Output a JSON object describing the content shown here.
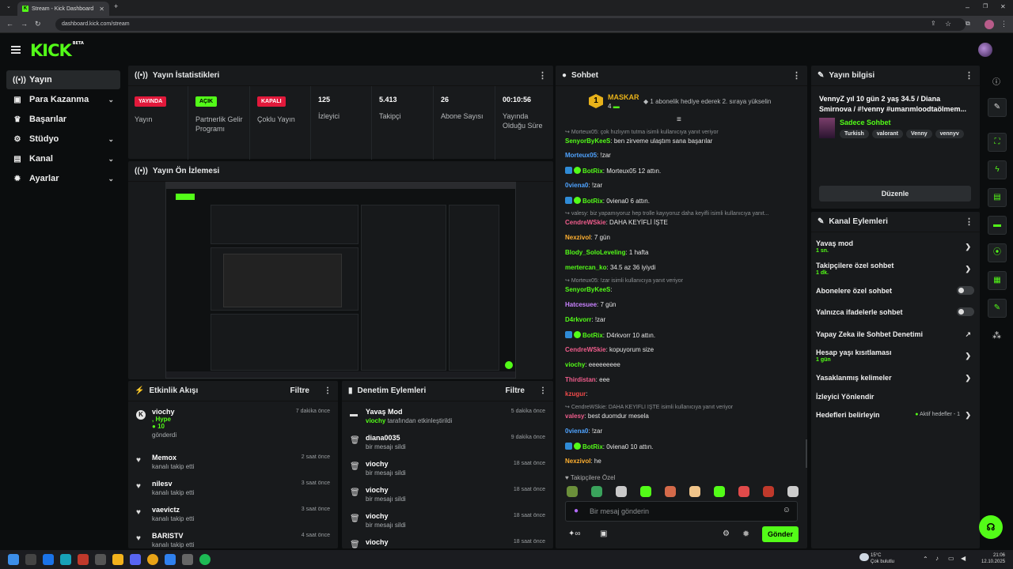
{
  "browser": {
    "tab_title": "Stream - Kick Dashboard",
    "url": "dashboard.kick.com/stream"
  },
  "brand": {
    "logo": "KICK",
    "beta": "BETA",
    "accent": "#53fc18"
  },
  "sidebar": {
    "items": [
      {
        "label": "Yayın",
        "icon": "broadcast-icon"
      },
      {
        "label": "Para Kazanma",
        "icon": "wallet-icon"
      },
      {
        "label": "Başarılar",
        "icon": "trophy-icon"
      },
      {
        "label": "Stüdyo",
        "icon": "gear-icon"
      },
      {
        "label": "Kanal",
        "icon": "folder-icon"
      },
      {
        "label": "Ayarlar",
        "icon": "settings-icon"
      }
    ]
  },
  "stats": {
    "title": "Yayın İstatistikleri",
    "items": [
      {
        "badge": "YAYINDA",
        "label": "Yayın"
      },
      {
        "badge": "AÇIK",
        "label": "Partnerlik Gelir Programı"
      },
      {
        "badge": "KAPALI",
        "label": "Çoklu Yayın"
      },
      {
        "value": "125",
        "label": "İzleyici"
      },
      {
        "value": "5.413",
        "label": "Takipçi"
      },
      {
        "value": "26",
        "label": "Abone Sayısı"
      },
      {
        "value": "00:10:56",
        "label": "Yayında Olduğu Süre"
      }
    ]
  },
  "preview": {
    "title": "Yayın Ön İzlemesi"
  },
  "activity": {
    "title": "Etkinlik Akışı",
    "filter": "Filtre",
    "rows": [
      {
        "name": "viochy",
        "line2": ", Hype",
        "line3": "10",
        "line4": "gönderdi",
        "time": "7 dakika önce"
      },
      {
        "name": "Memox",
        "sub": "kanalı takip etti",
        "time": "2 saat önce"
      },
      {
        "name": "nilesv",
        "sub": "kanalı takip etti",
        "time": "3 saat önce"
      },
      {
        "name": "vaevictz",
        "sub": "kanalı takip etti",
        "time": "3 saat önce"
      },
      {
        "name": "BARISTV",
        "sub": "kanalı takip etti",
        "time": "4 saat önce"
      }
    ]
  },
  "moderation": {
    "title": "Denetim Eylemleri",
    "filter": "Filtre",
    "rows": [
      {
        "name": "Yavaş Mod",
        "sub_user": "viochy",
        "sub": "tarafından etkinleştirildi",
        "time": "5 dakika önce"
      },
      {
        "name": "diana0035",
        "sub": "bir mesajı sildi",
        "time": "9 dakika önce"
      },
      {
        "name": "viochy",
        "sub": "bir mesajı sildi",
        "time": "18 saat önce"
      },
      {
        "name": "viochy",
        "sub": "bir mesajı sildi",
        "time": "18 saat önce"
      },
      {
        "name": "viochy",
        "sub": "bir mesajı sildi",
        "time": "18 saat önce"
      },
      {
        "name": "viochy",
        "sub": "",
        "time": "18 saat önce"
      }
    ]
  },
  "chat": {
    "title": "Sohbet",
    "pinned_user": "MASKAR",
    "pinned_count": "4",
    "pinned_rank": "1",
    "pinned_msg": "1 abonelik hediye ederek 2. sıraya yükselin",
    "messages": [
      {
        "reply": "Morteux05: çok hızlıyım tutma isimli kullanıcıya yanıt veriyor"
      },
      {
        "user": "SenyorByKeeS",
        "color": "#53fc18",
        "text": "ben zirveme ulaştım sana başarılar"
      },
      {
        "user": "Morteux05",
        "color": "#4fa3ff",
        "text": "!zar"
      },
      {
        "user": "BotRix",
        "color": "#53fc18",
        "text": "Morteux05 12 attın.",
        "badges": true
      },
      {
        "user": "0viena0",
        "color": "#4fa3ff",
        "text": "!zar"
      },
      {
        "user": "BotRix",
        "color": "#53fc18",
        "text": "0viena0 6 attın.",
        "badges": true
      },
      {
        "reply": "valesy: biz yapamıyoruz hep trolle kayıyoruz daha keyifli isimli kullanıcıya yanıt..."
      },
      {
        "user": "CendreWSkie",
        "color": "#f05d8c",
        "text": "DAHA KEYİFLİ İŞTE"
      },
      {
        "user": "Nexzivol",
        "color": "#ffb030",
        "text": "7 gün"
      },
      {
        "user": "Blody_SoloLeveling",
        "color": "#53fc18",
        "text": "1 hafta"
      },
      {
        "user": "mertercan_ko",
        "color": "#53fc18",
        "text": "34.5 az 36 iyiydi"
      },
      {
        "reply": "Morteux05: !zar isimli kullanıcıya yanıt veriyor"
      },
      {
        "user": "SenyorByKeeS",
        "color": "#53fc18",
        "text": ""
      },
      {
        "user": "Hatcesuee",
        "color": "#c982ff",
        "text": "7 gün"
      },
      {
        "user": "D4rkvorr",
        "color": "#53fc18",
        "text": "!zar"
      },
      {
        "user": "BotRix",
        "color": "#53fc18",
        "text": "D4rkvorr 10 attın.",
        "badges": true
      },
      {
        "user": "CendreWSkie",
        "color": "#f05d8c",
        "text": "kopuyorum size"
      },
      {
        "user": "viochy",
        "color": "#53fc18",
        "text": "eeeeeeeee"
      },
      {
        "user": "Thirdistan",
        "color": "#f05d8c",
        "text": "eee"
      },
      {
        "user": "kzugur",
        "color": "#f04a4a",
        "text": ""
      },
      {
        "reply": "CendreWSkie: DAHA KEYİFLİ İŞTE isimli kullanıcıya yanıt veriyor"
      },
      {
        "user": "valesy",
        "color": "#f05d8c",
        "text": "best duomdur mesela"
      },
      {
        "user": "0viena0",
        "color": "#4fa3ff",
        "text": "!zar"
      },
      {
        "user": "BotRix",
        "color": "#53fc18",
        "text": "0viena0 10 attın.",
        "badges": true
      },
      {
        "user": "Nexzivol",
        "color": "#ffb030",
        "text": "he"
      }
    ],
    "emote_label": "Takipçilere Özel",
    "input_placeholder": "Bir mesaj gönderin",
    "send_label": "Gönder"
  },
  "stream_info": {
    "title": "Yayın bilgisi",
    "stream_title": "VennyZ yıl 10 gün 2 yaş 34.5 / Diana Smirnova / #!venny #umarımloodtaölmem...",
    "category": "Sadece Sohbet",
    "tags": [
      "Turkish",
      "valorant",
      "Venny",
      "vennyv"
    ],
    "edit_label": "Düzenle"
  },
  "channel_actions": {
    "title": "Kanal Eylemleri",
    "items": [
      {
        "label": "Yavaş mod",
        "sub": "1 sn.",
        "kind": "chevron"
      },
      {
        "label": "Takipçilere özel sohbet",
        "sub": "1 dk.",
        "kind": "chevron"
      },
      {
        "label": "Abonelere özel sohbet",
        "kind": "toggle"
      },
      {
        "label": "Yalnızca ifadelerle sohbet",
        "kind": "toggle"
      },
      {
        "label": "Yapay Zeka ile Sohbet Denetimi",
        "kind": "external"
      },
      {
        "label": "Hesap yaşı kısıtlaması",
        "sub": "1 gün",
        "kind": "chevron"
      },
      {
        "label": "Yasaklanmış kelimeler",
        "kind": "chevron"
      },
      {
        "label": "İzleyici Yönlendir",
        "kind": "none"
      },
      {
        "label": "Hedefleri belirleyin",
        "status": "Aktif hedefler - 1",
        "kind": "chevron"
      }
    ]
  },
  "taskbar": {
    "weather_temp": "15°C",
    "weather_desc": "Çok bulutlu",
    "time": "21:06",
    "date": "12.10.2025"
  }
}
